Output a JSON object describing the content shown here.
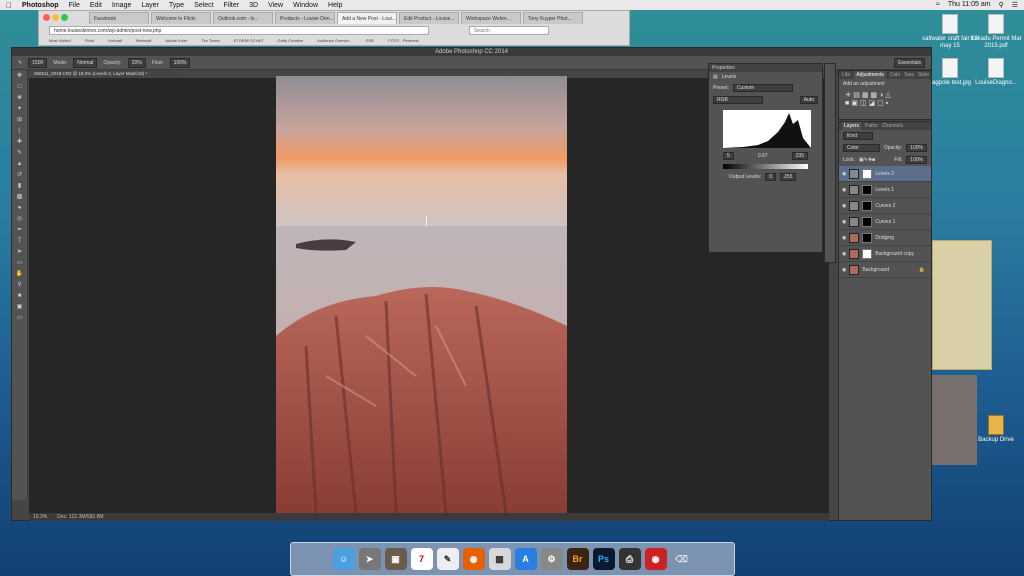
{
  "menubar": {
    "app": "Photoshop",
    "items": [
      "File",
      "Edit",
      "Image",
      "Layer",
      "Type",
      "Select",
      "Filter",
      "3D",
      "View",
      "Window",
      "Help"
    ],
    "clock": "Thu 11:05 am"
  },
  "desktop": {
    "icons": [
      {
        "label": "saltwater craft fair 10 may 15"
      },
      {
        "label": "Kakadu Permit Mar 2015.pdf"
      },
      {
        "label": "flagpole test.jpg"
      },
      {
        "label": "LouiseDiagno..."
      },
      {
        "label": "Backup Drive"
      }
    ]
  },
  "browser": {
    "tabs": [
      "Facebook",
      "Welcome to Flickr",
      "Outlook.com - lo...",
      "Products - Louise Den...",
      "Add a New Post - Loui...",
      "Edit Product - Louise...",
      "Workspace Webm...",
      "Tony Kuyper Phot..."
    ],
    "active_tab": 4,
    "url": "home.louisedenton.com/wp-admin/post-new.php",
    "search_placeholder": "Search",
    "bookmarks": [
      "Most Visited",
      "Flickr",
      "Hotmail",
      "Webmail",
      "Adobe Kuler",
      "Tim Times",
      "STORMY2CHAT",
      "Getty Creative",
      "Audience Overvie...",
      "ERE",
      "FOTO - Pinterest"
    ]
  },
  "photoshop": {
    "title": "Adobe Photoshop CC 2014",
    "workspace": "Essentials",
    "options": {
      "mode_label": "Mode:",
      "mode": "Normal",
      "opacity_label": "Opacity:",
      "opacity": "20%",
      "flow_label": "Flow:",
      "flow": "100%",
      "brush_size": "1500"
    },
    "doc_tab": "060511_0018.CR2 @ 19.3% (Levels 2, Layer Mask/16) *",
    "status": {
      "zoom": "19.3%",
      "doc": "Doc: 122.3M/581.8M"
    },
    "properties": {
      "header": "Properties",
      "panel_title": "Levels",
      "preset_label": "Preset:",
      "preset": "Custom",
      "channel": "RGB",
      "auto": "Auto",
      "input_black": "5",
      "input_mid": "0.67",
      "input_white": "235",
      "output_label": "Output Levels:",
      "output_black": "0",
      "output_white": "255"
    },
    "adjustments": {
      "tabs": [
        "Libr",
        "Adjustments",
        "Colo",
        "Swa",
        "Style"
      ],
      "title": "Add an adjustment"
    },
    "layers": {
      "tabs": [
        "Layers",
        "Paths",
        "Channels"
      ],
      "kind": "Kind",
      "blend": "Color",
      "opacity_label": "Opacity:",
      "opacity": "100%",
      "lock_label": "Lock:",
      "fill_label": "Fill:",
      "fill": "100%",
      "items": [
        {
          "name": "Levels 2",
          "selected": true
        },
        {
          "name": "Levels 1",
          "selected": false
        },
        {
          "name": "Curves 2",
          "selected": false
        },
        {
          "name": "Curves 1",
          "selected": false
        },
        {
          "name": "Dodging",
          "selected": false
        },
        {
          "name": "Background copy",
          "selected": false
        },
        {
          "name": "Background",
          "selected": false
        }
      ]
    }
  },
  "dock": {
    "apps": [
      "Finder",
      "Launchpad",
      "Photo",
      "Calendar",
      "TextEdit",
      "Firefox",
      "Preview",
      "App Store",
      "System Prefs",
      "Br",
      "Ps",
      "Printer",
      "Photo Booth",
      "Trash"
    ]
  },
  "colors": {
    "accent": "#5c6e8c",
    "ps_panel": "#535353"
  }
}
